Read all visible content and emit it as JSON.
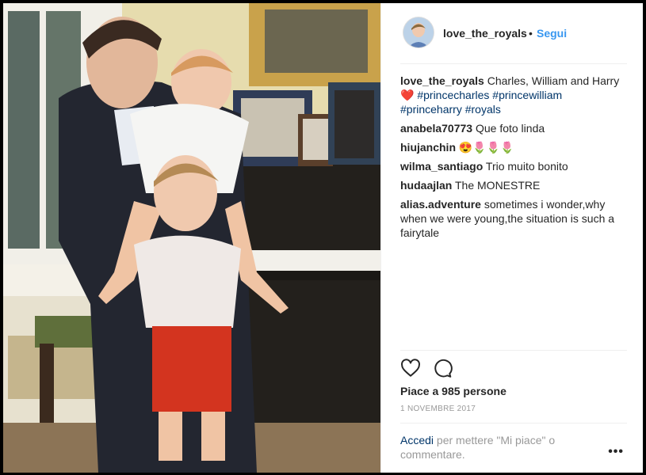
{
  "post": {
    "username": "love_the_royals",
    "separator": "•",
    "follow_label": "Segui",
    "caption": {
      "username": "love_the_royals",
      "text": "Charles, William and Harry",
      "emoji": "❤️",
      "hashtags": [
        "#princecharles",
        "#princewilliam",
        "#princeharry",
        "#royals"
      ]
    },
    "comments": [
      {
        "user": "anabela70773",
        "text": "Que foto linda"
      },
      {
        "user": "hiujanchin",
        "text": "😍🌷🌷🌷"
      },
      {
        "user": "wilma_santiago",
        "text": "Trio muito bonito"
      },
      {
        "user": "hudaajlan",
        "text": "The MONESTRE"
      },
      {
        "user": "alias.adventure",
        "text": "sometimes i wonder,why when we were young,the situation is such a fairytale"
      }
    ],
    "likes_text": "Piace a 985 persone",
    "date": "1 NOVEMBRE 2017",
    "add_comment": {
      "login_link": "Accedi",
      "rest": "per mettere \"Mi piace\" o commentare."
    },
    "more_label": "•••"
  },
  "icons": {
    "like": "heart-icon",
    "comment": "comment-icon",
    "more": "more-options-icon"
  },
  "colors": {
    "follow": "#3897f0",
    "hashtag": "#003569",
    "text": "#262626",
    "muted": "#999999",
    "heart": "#ed4956"
  }
}
